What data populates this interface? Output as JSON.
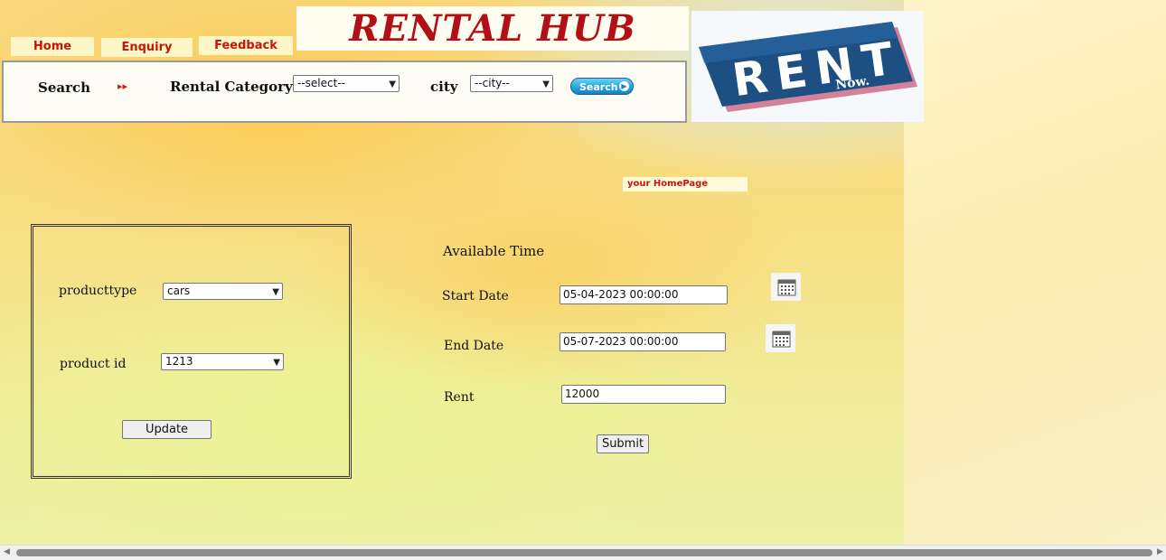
{
  "nav": {
    "home": "Home",
    "enquiry": "Enquiry",
    "feedback": "Feedback"
  },
  "header": {
    "title": "RENTAL HUB"
  },
  "logo": {
    "word": "RENT",
    "sub": "Now."
  },
  "search": {
    "label": "Search",
    "arrows": "▸▸",
    "category_label": "Rental Category",
    "category_value": "--select--",
    "city_label": "city",
    "city_value": "--city--",
    "button_label": "Search"
  },
  "badge": {
    "homepage": "your HomePage"
  },
  "update_form": {
    "producttype_label": "producttype",
    "producttype_value": "cars",
    "product_id_label": "product id",
    "product_id_value": "1213",
    "update_button": "Update"
  },
  "availability": {
    "heading": "Available Time",
    "start_label": "Start Date",
    "start_value": "05-04-2023 00:00:00",
    "end_label": "End Date",
    "end_value": "05-07-2023 00:00:00",
    "rent_label": "Rent",
    "rent_value": "12000",
    "submit_button": "Submit"
  },
  "colors": {
    "accent_red": "#c8150a",
    "title_red": "#b01016",
    "search_blue": "#27a6e0",
    "logo_blue": "#1d4f82"
  }
}
